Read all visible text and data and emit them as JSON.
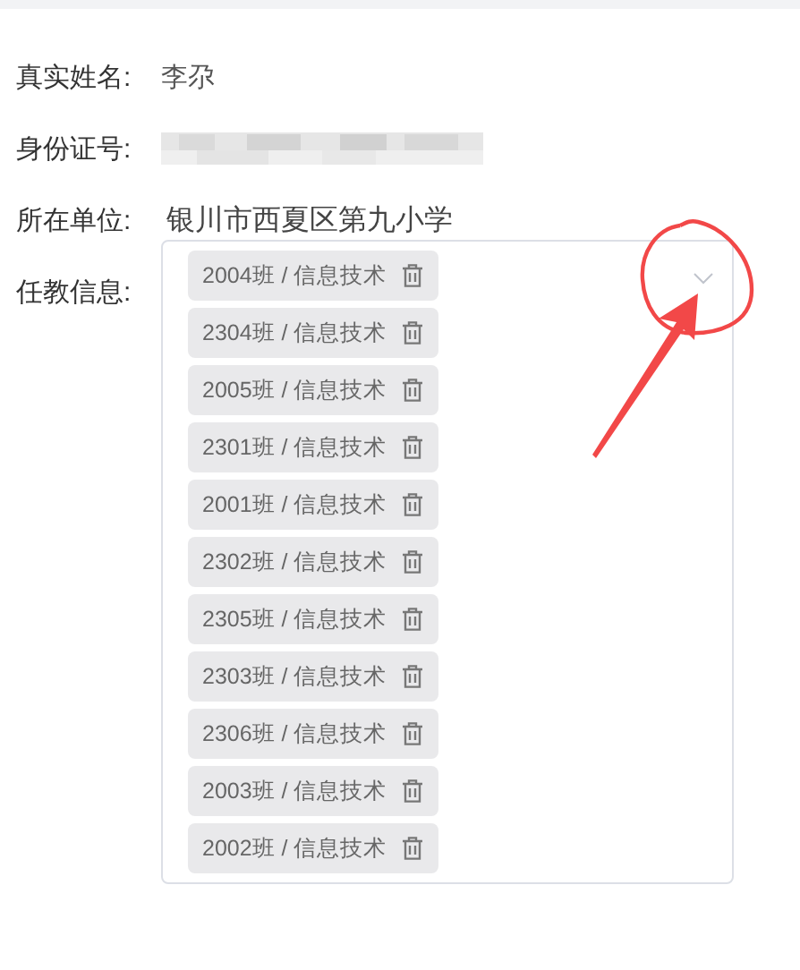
{
  "fields": [
    {
      "label": "真实姓名:",
      "kind": "text",
      "value": "李尕"
    },
    {
      "label": "身份证号:",
      "kind": "redacted"
    },
    {
      "label": "所在单位:",
      "kind": "large",
      "value": "银川市西夏区第九小学"
    },
    {
      "label": "任教信息:",
      "kind": "tags",
      "tags": [
        {
          "text": "2004班 / 信息技术"
        },
        {
          "text": "2304班 / 信息技术"
        },
        {
          "text": "2005班 / 信息技术"
        },
        {
          "text": "2301班 / 信息技术"
        },
        {
          "text": "2001班 / 信息技术"
        },
        {
          "text": "2302班 / 信息技术"
        },
        {
          "text": "2305班 / 信息技术"
        },
        {
          "text": "2303班 / 信息技术"
        },
        {
          "text": "2306班 / 信息技术"
        },
        {
          "text": "2003班 / 信息技术"
        },
        {
          "text": "2002班 / 信息技术"
        }
      ]
    }
  ]
}
